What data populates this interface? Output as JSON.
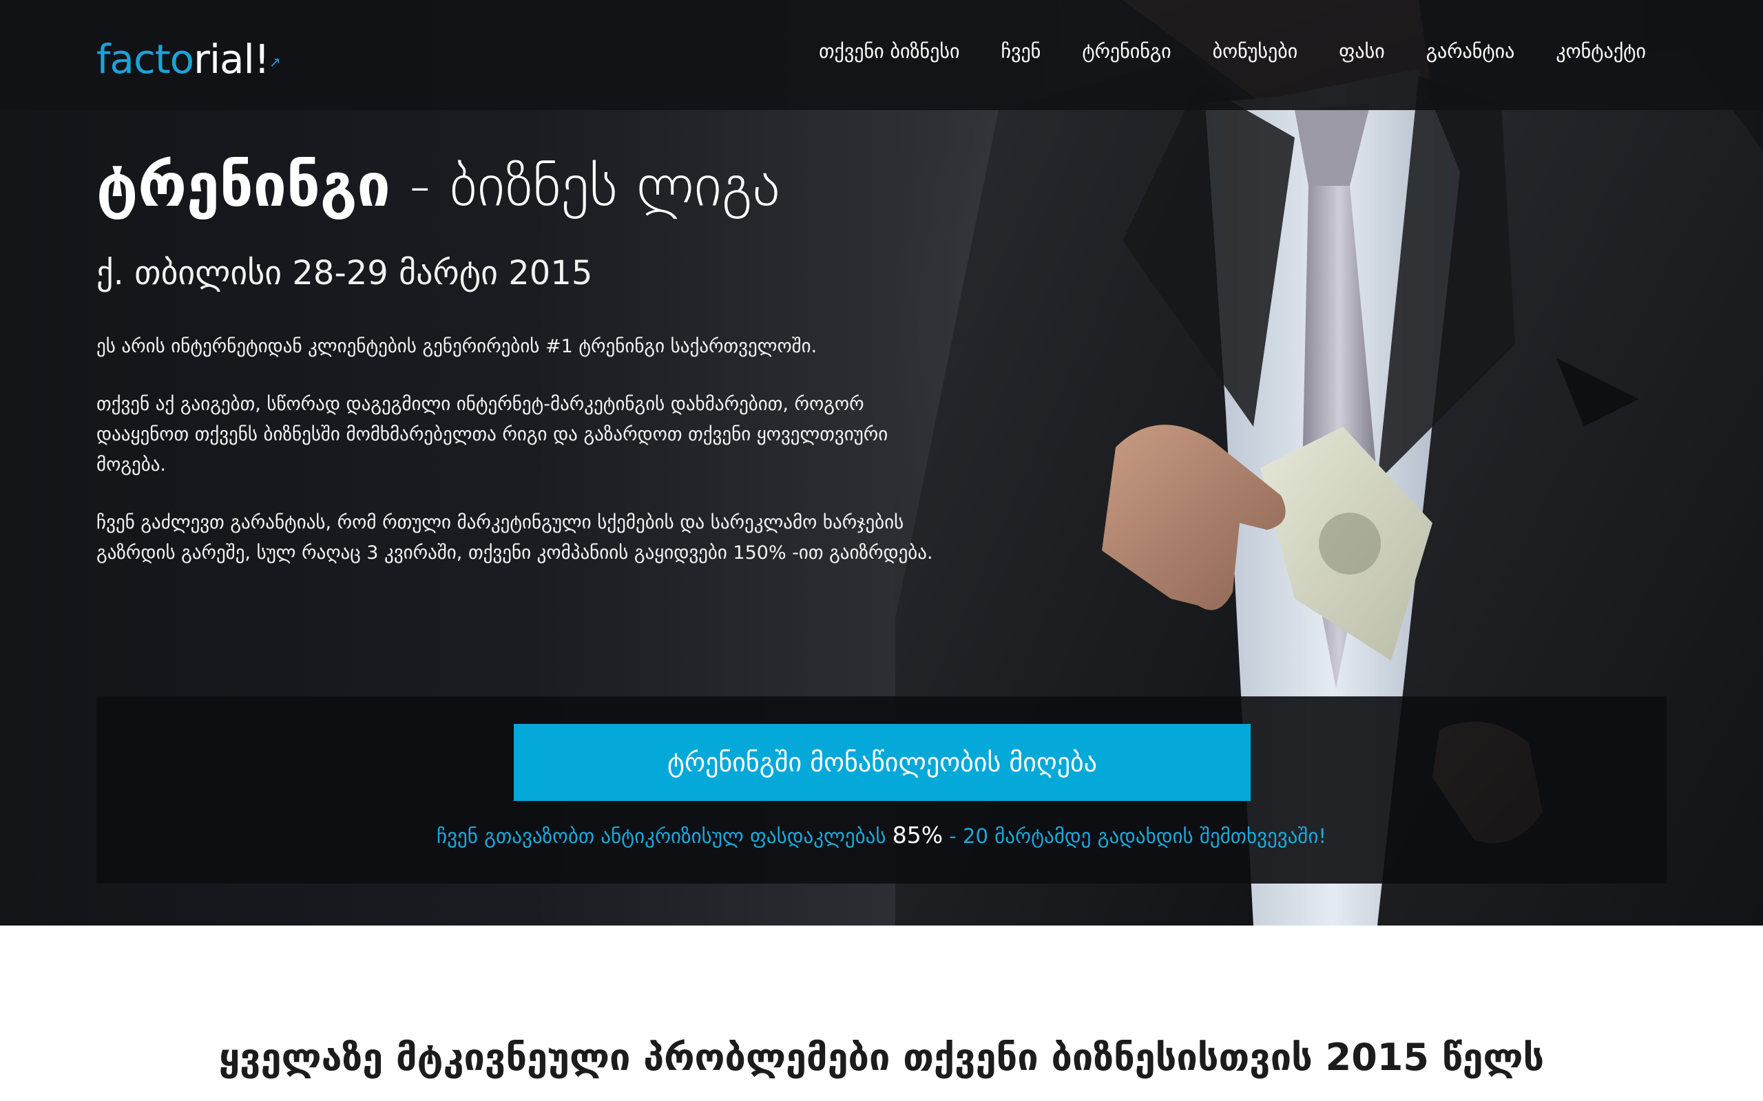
{
  "logo": {
    "part1": "fac",
    "part2": "to",
    "part3": "rial!",
    "superscript": "↗"
  },
  "nav": {
    "items": [
      "თქვენი ბიზნესი",
      "ჩვენ",
      "ტრენინგი",
      "ბონუსები",
      "ფასი",
      "გარანტია",
      "კონტაქტი"
    ]
  },
  "hero": {
    "title_bold": "ტრენინგი",
    "title_rest": " - ბიზნეს ლიგა",
    "subtitle": "ქ. თბილისი  28-29 მარტი 2015",
    "paragraphs": [
      "ეს არის ინტერნეტიდან კლიენტების გენერირების #1 ტრენინგი საქართველოში.",
      "თქვენ აქ გაიგებთ, სწორად დაგეგმილი ინტერნეტ-მარკეტინგის დახმარებით, როგორ დააყენოთ თქვენს ბიზნესში მომხმარებელთა რიგი და გაზარდოთ თქვენი ყოველთვიური მოგება.",
      "ჩვენ გაძლევთ გარანტიას, რომ რთული მარკეტინგული სქემების და სარეკლამო ხარჯების გაზრდის გარეშე, სულ რაღაც 3 კვირაში, თქვენი კომპანიის გაყიდვები 150% -ით გაიზრდება."
    ]
  },
  "cta": {
    "button_label": "ტრენინგში მონაწილეობის მიღება",
    "note_before": "ჩვენ გთავაზობთ ანტიკრიზისულ ფასდაკლებას ",
    "note_percent": "85%",
    "note_after": " - 20 მარტამდე გადახდის შემთხვევაში!"
  },
  "section": {
    "heading": "ყველაზე მტკივნეული პრობლემები თქვენი ბიზნესისთვის 2015 წელს"
  },
  "colors": {
    "accent": "#04a8d9",
    "navbar": "#111216",
    "panel": "#0c0d11"
  }
}
